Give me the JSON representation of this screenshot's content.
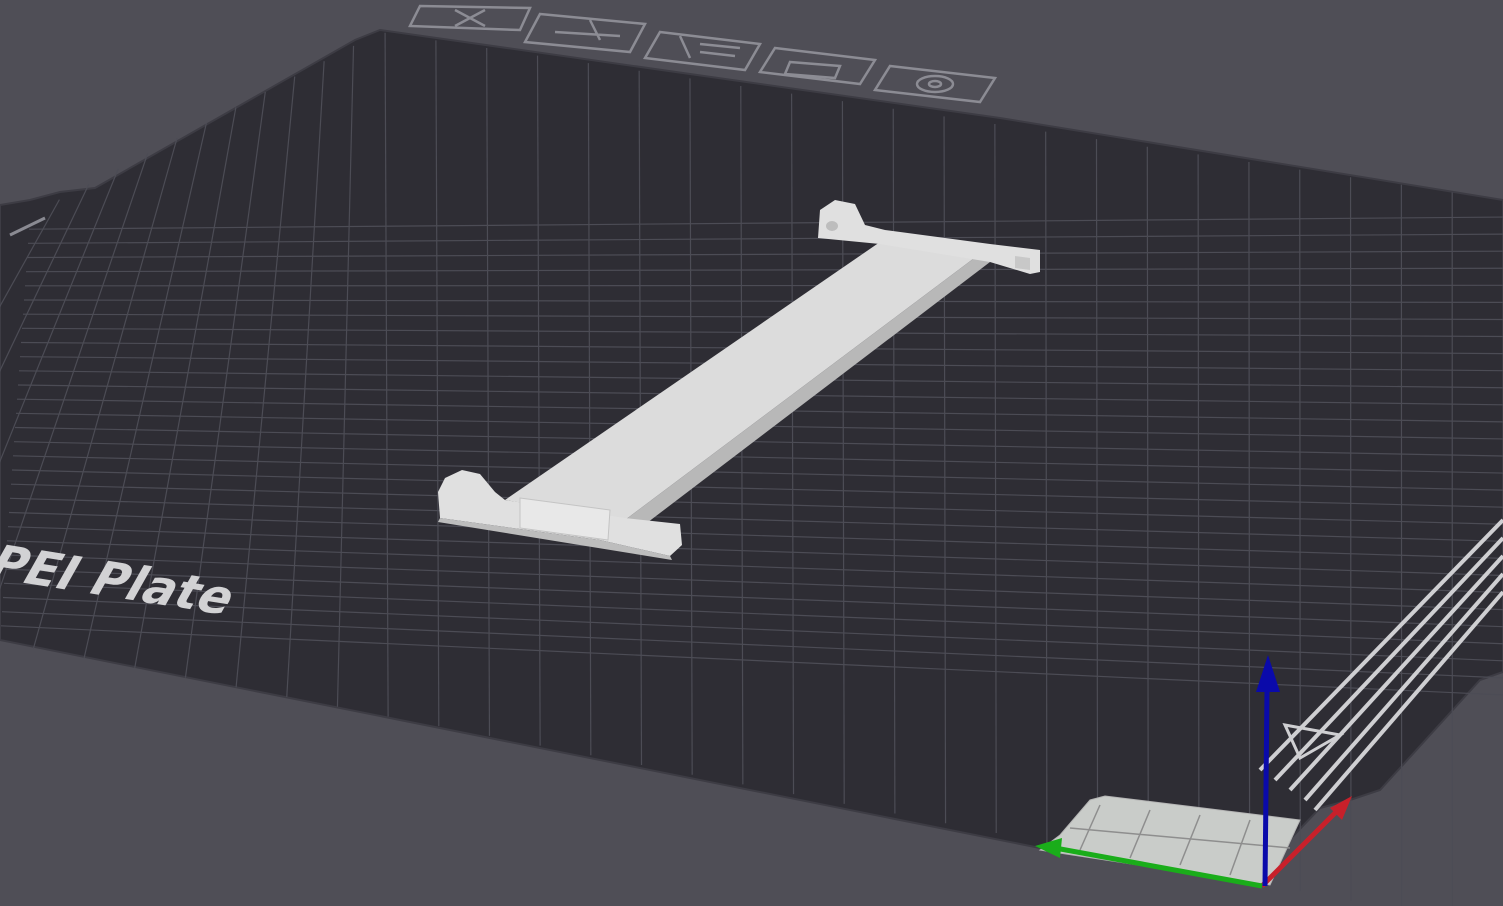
{
  "viewport": {
    "background_color": "#4f4e56",
    "bed_color": "#2e2d34",
    "bed_edge_color": "#3b3a42",
    "grid_color": "#4a4a52",
    "model_color": "#d9d9d9"
  },
  "bed": {
    "plate_label": "red PEI Plate",
    "icons": [
      "close-icon",
      "print-settings-icon",
      "filament-icon",
      "plate-icon",
      "settings-icon"
    ]
  },
  "model": {
    "name": "spool-holder-bar"
  },
  "axes": {
    "x_color": "#c8202a",
    "y_color": "#1aad1a",
    "z_color": "#0a0aaa"
  }
}
